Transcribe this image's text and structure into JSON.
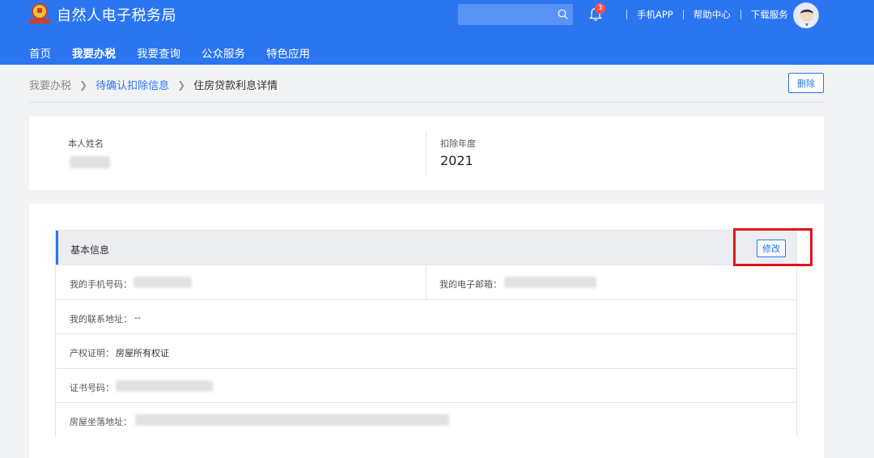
{
  "header": {
    "site_title": "自然人电子税务局",
    "emblem_icon": "tax-emblem-icon",
    "search": {
      "placeholder": "",
      "icon": "search-icon"
    },
    "notifications": {
      "icon": "bell-icon",
      "count": "3"
    },
    "links": [
      "手机APP",
      "帮助中心",
      "下载服务"
    ],
    "avatar_icon": "user-avatar-icon",
    "accent_color": "#2b75f0"
  },
  "nav": {
    "items": [
      "首页",
      "我要办税",
      "我要查询",
      "公众服务",
      "特色应用"
    ],
    "active": "我要办税"
  },
  "breadcrumb": {
    "items": [
      "我要办税",
      "待确认扣除信息",
      "住房贷款利息详情"
    ],
    "separator_icon": "chevron-right-icon",
    "delete_label": "删除"
  },
  "summary": {
    "name_label": "本人姓名",
    "name_value": "",
    "year_label": "扣除年度",
    "year_value": "2021"
  },
  "basic_info": {
    "title": "基本信息",
    "edit_label": "修改",
    "phone_label": "我的手机号码：",
    "email_label": "我的电子邮箱：",
    "address_label": "我的联系地址：",
    "address_value": "--",
    "property_proof_label": "产权证明：",
    "property_proof_value": "房屋所有权证",
    "cert_no_label": "证书号码：",
    "house_location_label": "房屋坐落地址：",
    "highlight_color": "#e1141a"
  }
}
